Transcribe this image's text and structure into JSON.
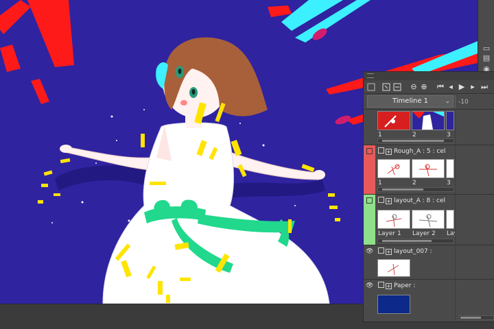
{
  "canvas": {
    "background": "#2f23a0",
    "brush_colors": {
      "red": "#ff1a1a",
      "cyan": "#3df0ff",
      "magenta": "#d21d6e",
      "yellow": "#ffe400",
      "green": "#21d88c",
      "dress": "#ffffff",
      "hair": "#a8603a"
    }
  },
  "right_strip": {
    "buttons": [
      {
        "icon": "window-icon"
      },
      {
        "icon": "folder-icon"
      },
      {
        "icon": "disc-icon"
      }
    ]
  },
  "timeline": {
    "toolbar": {
      "buttons": [
        {
          "icon": "new-cel-icon"
        },
        {
          "icon": "link-icon"
        },
        {
          "icon": "zoom-out-icon",
          "glyph": "⊖"
        },
        {
          "icon": "zoom-in-icon",
          "glyph": "⊕"
        },
        {
          "icon": "first-frame-icon",
          "glyph": "⏮"
        },
        {
          "icon": "prev-frame-icon",
          "glyph": "◂"
        },
        {
          "icon": "play-icon",
          "glyph": "▶"
        },
        {
          "icon": "next-frame-icon",
          "glyph": "▸"
        },
        {
          "icon": "last-frame-icon",
          "glyph": "⏭"
        }
      ]
    },
    "selector": {
      "value": "Timeline 1"
    },
    "ruler": {
      "label": "-10"
    },
    "tracks": [
      {
        "id": "preview",
        "name": "",
        "color": "",
        "frames": [
          "1",
          "2",
          "3"
        ]
      },
      {
        "id": "rough",
        "name": "Rough_A : 5 : cel",
        "color": "#e85a5a",
        "frames": [
          "1",
          "2",
          "3"
        ]
      },
      {
        "id": "layout",
        "name": "layout_A : 8 : cel",
        "color": "#8fe08a",
        "frames": [
          "Layer 1",
          "Layer 2",
          "Lay"
        ]
      },
      {
        "id": "layout007",
        "name": "layout_007 :",
        "color": "",
        "frames": []
      },
      {
        "id": "paper",
        "name": "Paper :",
        "color": "",
        "frames": []
      }
    ]
  }
}
